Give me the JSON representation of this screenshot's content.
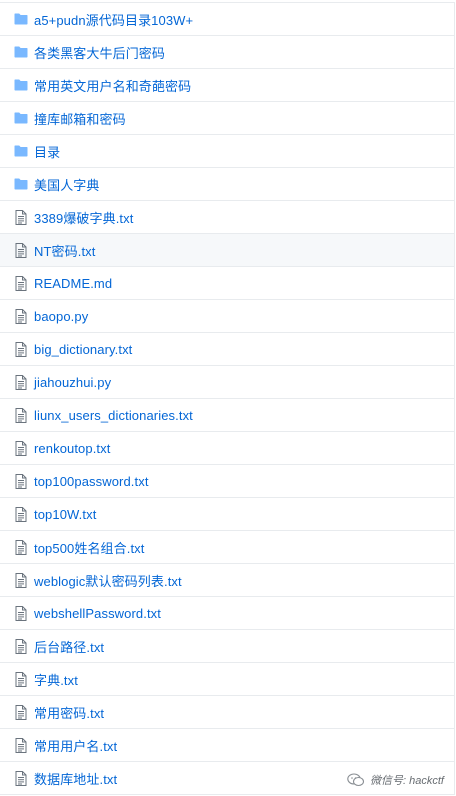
{
  "colors": {
    "link": "#0366d6",
    "folder_icon": "#79b8ff",
    "file_icon": "#6a737d",
    "border": "#e8ebee",
    "row_highlight": "#f6f8fa"
  },
  "files": [
    {
      "type": "folder",
      "icon": "folder-icon",
      "name": "a5+pudn源代码目录103W+"
    },
    {
      "type": "folder",
      "icon": "folder-icon",
      "name": "各类黑客大牛后门密码"
    },
    {
      "type": "folder",
      "icon": "folder-icon",
      "name": "常用英文用户名和奇葩密码"
    },
    {
      "type": "folder",
      "icon": "folder-icon",
      "name": "撞库邮箱和密码"
    },
    {
      "type": "folder",
      "icon": "folder-icon",
      "name": "目录"
    },
    {
      "type": "folder",
      "icon": "folder-icon",
      "name": "美国人字典"
    },
    {
      "type": "file",
      "icon": "file-text-icon",
      "name": "3389爆破字典.txt"
    },
    {
      "type": "file",
      "icon": "file-text-icon",
      "name": "NT密码.txt",
      "highlight": true
    },
    {
      "type": "file",
      "icon": "file-text-icon",
      "name": "README.md"
    },
    {
      "type": "file",
      "icon": "file-text-icon",
      "name": "baopo.py"
    },
    {
      "type": "file",
      "icon": "file-text-icon",
      "name": "big_dictionary.txt"
    },
    {
      "type": "file",
      "icon": "file-text-icon",
      "name": "jiahouzhui.py"
    },
    {
      "type": "file",
      "icon": "file-text-icon",
      "name": "liunx_users_dictionaries.txt"
    },
    {
      "type": "file",
      "icon": "file-text-icon",
      "name": "renkoutop.txt"
    },
    {
      "type": "file",
      "icon": "file-text-icon",
      "name": "top100password.txt"
    },
    {
      "type": "file",
      "icon": "file-text-icon",
      "name": "top10W.txt"
    },
    {
      "type": "file",
      "icon": "file-text-icon",
      "name": "top500姓名组合.txt"
    },
    {
      "type": "file",
      "icon": "file-text-icon",
      "name": "weblogic默认密码列表.txt"
    },
    {
      "type": "file",
      "icon": "file-text-icon",
      "name": "webshellPassword.txt"
    },
    {
      "type": "file",
      "icon": "file-text-icon",
      "name": "后台路径.txt"
    },
    {
      "type": "file",
      "icon": "file-text-icon",
      "name": "字典.txt"
    },
    {
      "type": "file",
      "icon": "file-text-icon",
      "name": "常用密码.txt"
    },
    {
      "type": "file",
      "icon": "file-text-icon",
      "name": "常用用户名.txt"
    },
    {
      "type": "file",
      "icon": "file-text-icon",
      "name": "数据库地址.txt"
    }
  ],
  "watermark": {
    "icon": "wechat-icon",
    "text": "微信号: hackctf"
  }
}
